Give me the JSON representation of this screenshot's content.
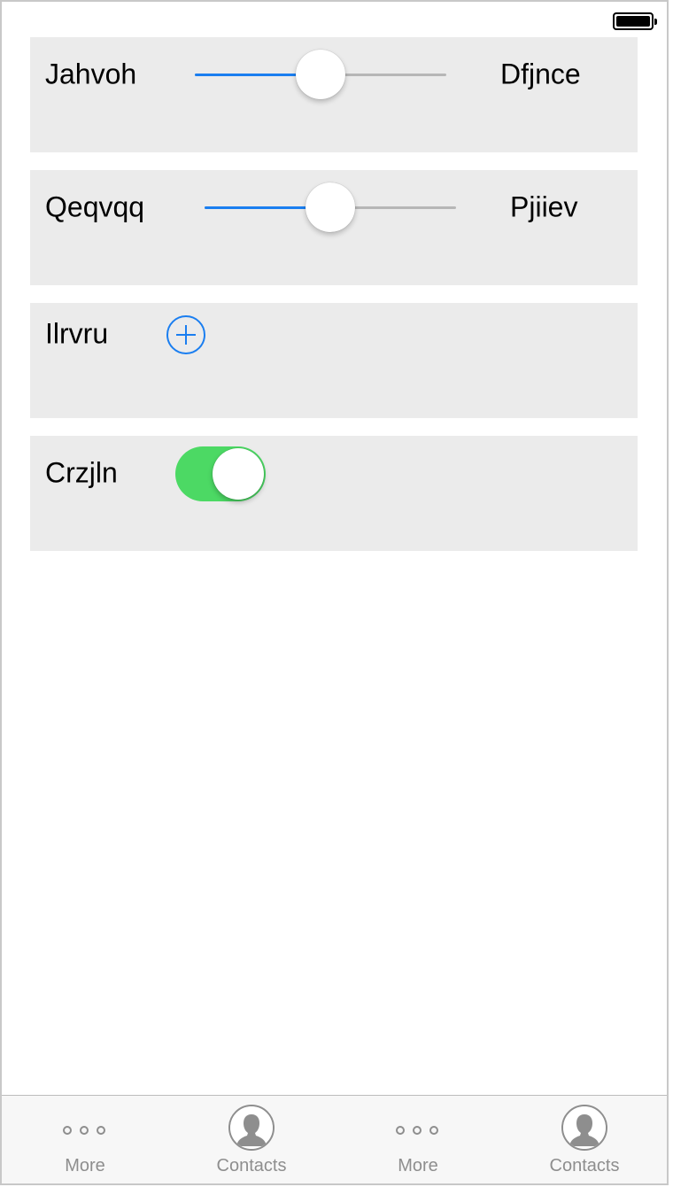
{
  "rows": [
    {
      "left_label": "Jahvoh",
      "right_label": "Dfjnce",
      "slider_value_fraction": 0.5
    },
    {
      "left_label": "Qeqvqq",
      "right_label": "Pjiiev",
      "slider_value_fraction": 0.5
    }
  ],
  "add_row": {
    "label": "Ilrvru",
    "icon": "plus-circle-icon"
  },
  "toggle_row": {
    "label": "Crzjln",
    "state": "on",
    "on_color": "#4cd964"
  },
  "accent_color": "#1a7ef0",
  "tab_bar": {
    "items": [
      {
        "label": "More",
        "icon": "more-dots-icon"
      },
      {
        "label": "Contacts",
        "icon": "contact-icon"
      },
      {
        "label": "More",
        "icon": "more-dots-icon"
      },
      {
        "label": "Contacts",
        "icon": "contact-icon"
      }
    ]
  }
}
